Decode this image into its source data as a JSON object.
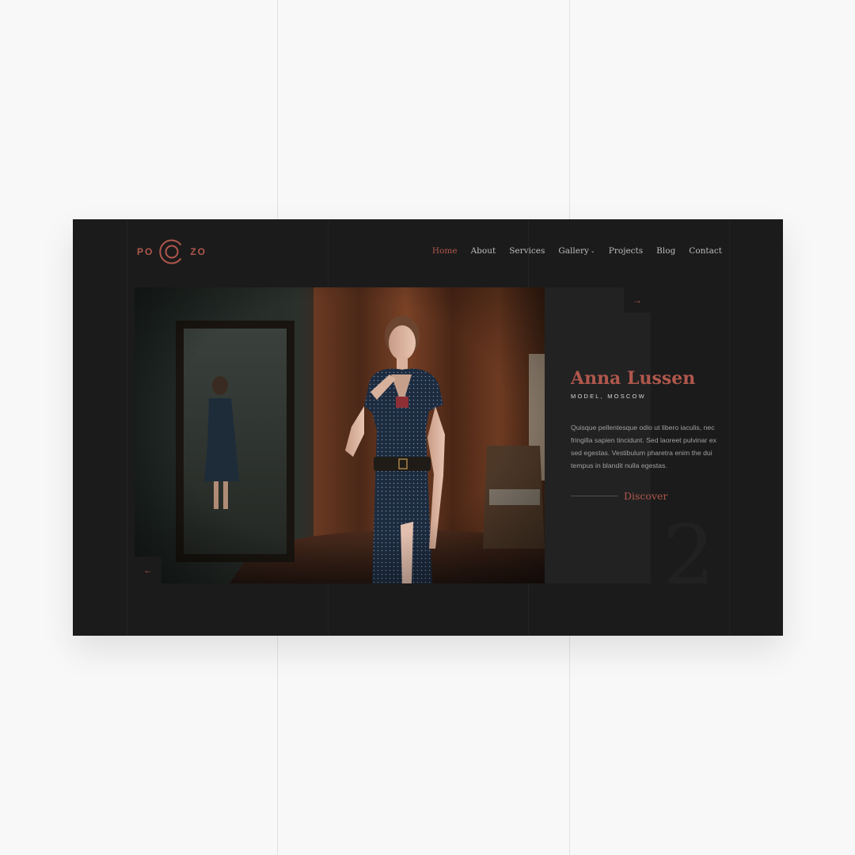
{
  "logo": {
    "left_text": "PO",
    "right_text": "ZO"
  },
  "nav": {
    "items": [
      "Home",
      "About",
      "Services",
      "Gallery",
      "Projects",
      "Blog",
      "Contact"
    ],
    "active": "Home"
  },
  "slider": {
    "prev_icon": "←",
    "next_icon": "→",
    "number": "2"
  },
  "profile": {
    "name": "Anna Lussen",
    "role": "MODEL, MOSCOW",
    "description": "Quisque pellentesque odio ut libero iaculis, nec fringilla sapien tincidunt. Sed laoreet pulvinar ex sed egestas. Vestibulum pharetra enim the dui tempus in blandit nulla egestas.",
    "cta": "Discover"
  },
  "colors": {
    "accent": "#b0574c",
    "background": "#1b1b1b",
    "panel": "#222222",
    "page": "#f8f8f8"
  }
}
